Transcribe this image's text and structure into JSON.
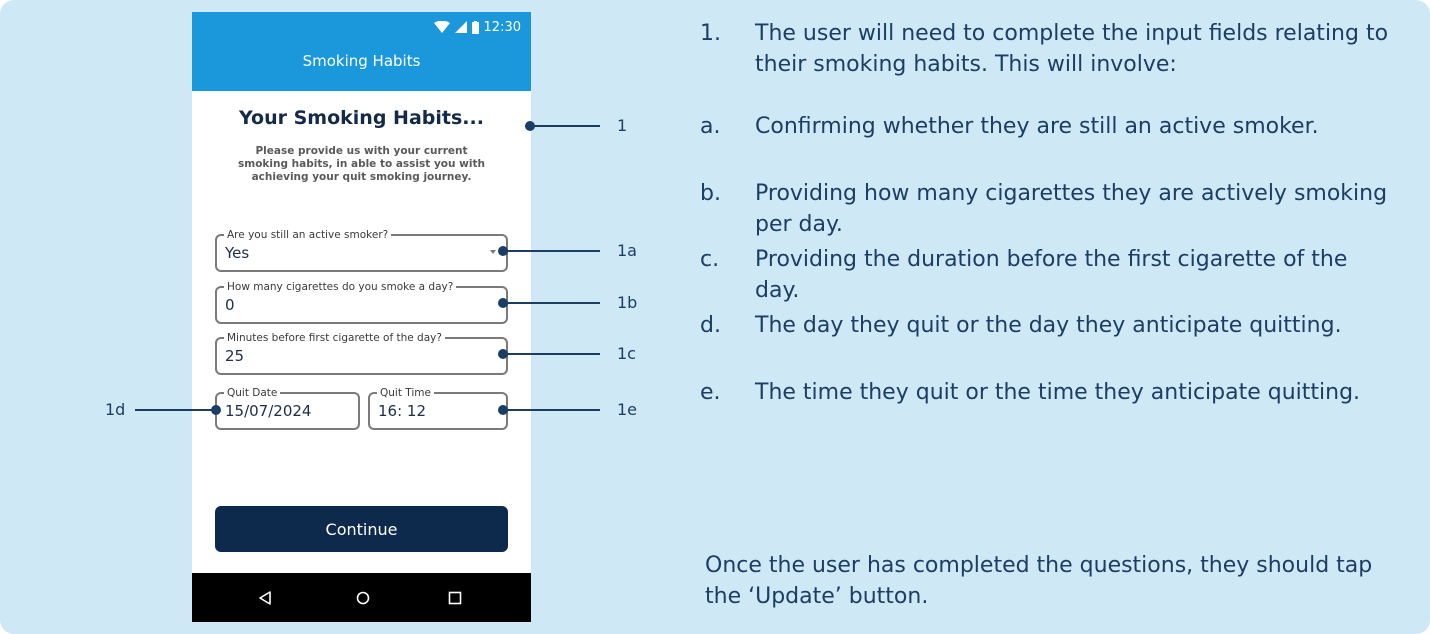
{
  "phone": {
    "status_time": "12:30",
    "app_title": "Smoking Habits",
    "heading": "Your Smoking Habits...",
    "subtext": "Please provide us with your current smoking habits, in able to assist you with achieving your quit smoking journey.",
    "fields": {
      "active_smoker": {
        "label": "Are you still an active smoker?",
        "value": "Yes"
      },
      "cigarettes_per_day": {
        "label": "How many cigarettes do you smoke a day?",
        "value": "0"
      },
      "minutes_before_first": {
        "label": "Minutes before first cigarette of the day?",
        "value": "25"
      },
      "quit_date": {
        "label": "Quit Date",
        "value": "15/07/2024"
      },
      "quit_time": {
        "label": "Quit Time",
        "value": "16: 12"
      }
    },
    "continue_label": "Continue",
    "nav_icons": [
      "back-icon",
      "home-icon",
      "recents-icon"
    ]
  },
  "callouts": {
    "c1": "1",
    "c1a": "1a",
    "c1b": "1b",
    "c1c": "1c",
    "c1d": "1d",
    "c1e": "1e"
  },
  "instructions": {
    "step1_mark": "1.",
    "step1_text": "The user will need to complete the input fields relating to their smoking habits. This will involve:",
    "items": [
      {
        "mark": "a.",
        "text": "Confirming whether they are still an active smoker."
      },
      {
        "mark": "b.",
        "text": "Providing how many cigarettes they are actively smoking per day."
      },
      {
        "mark": "c.",
        "text": "Providing the duration before the first cigarette of the day."
      },
      {
        "mark": "d.",
        "text": "The day they quit or the day they anticipate quitting."
      },
      {
        "mark": "e.",
        "text": "The time they quit or the time they anticipate quitting."
      }
    ],
    "footer": "Once the user has completed the questions, they should tap the ‘Update’ button."
  },
  "colors": {
    "background": "#cfe8f5",
    "app_bar": "#1a98db",
    "primary_button": "#0d2a4c",
    "callout": "#1c3d66"
  }
}
